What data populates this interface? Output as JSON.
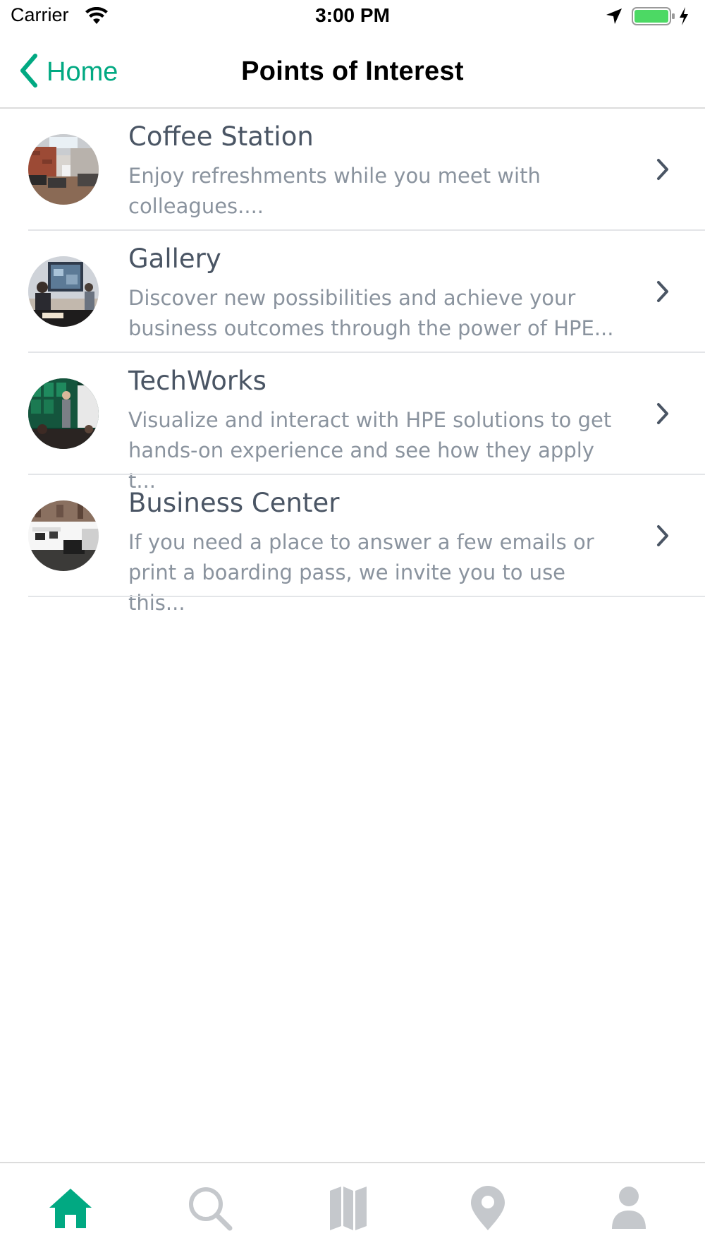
{
  "status_bar": {
    "carrier": "Carrier",
    "time": "3:00 PM"
  },
  "nav": {
    "back_label": "Home",
    "title": "Points of Interest"
  },
  "points": [
    {
      "title": "Coffee Station",
      "description": "Enjoy refreshments while you meet with colleagues....",
      "thumbnail_icon": "coffee-station-photo"
    },
    {
      "title": "Gallery",
      "description": "Discover new possibilities and achieve your business outcomes through the power of HPE...",
      "thumbnail_icon": "gallery-photo"
    },
    {
      "title": "TechWorks",
      "description": "Visualize and interact with HPE solutions to get hands-on experience and see how they apply t...",
      "thumbnail_icon": "techworks-photo"
    },
    {
      "title": "Business Center",
      "description": "If you need a place to answer a few emails or print a boarding pass, we invite you to use this...",
      "thumbnail_icon": "business-center-photo"
    }
  ],
  "tab_bar": {
    "tabs": [
      {
        "icon": "home-icon",
        "active": true
      },
      {
        "icon": "search-icon",
        "active": false
      },
      {
        "icon": "map-icon",
        "active": false
      },
      {
        "icon": "location-pin-icon",
        "active": false
      },
      {
        "icon": "profile-icon",
        "active": false
      }
    ]
  },
  "colors": {
    "accent": "#01a982",
    "title_text": "#4a5564",
    "description_text": "#8a939e",
    "inactive_icon": "#c5c8cc",
    "battery": "#4cd964"
  }
}
